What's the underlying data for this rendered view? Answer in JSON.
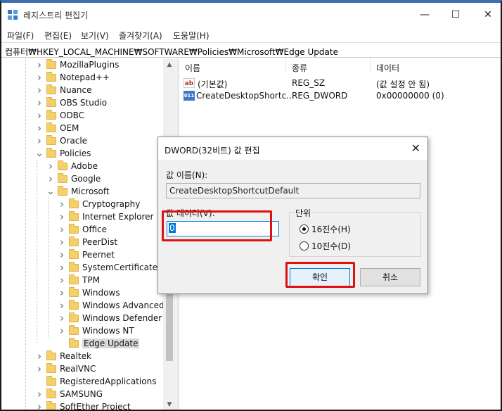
{
  "window": {
    "title": "레지스트리 편집기",
    "minimize": "—",
    "maximize": "☐",
    "close": "✕"
  },
  "menu": [
    "파일(F)",
    "편집(E)",
    "보기(V)",
    "즐겨찾기(A)",
    "도움말(H)"
  ],
  "address": "컴퓨터₩HKEY_LOCAL_MACHINE₩SOFTWARE₩Policies₩Microsoft₩Edge Update",
  "tree": [
    {
      "label": "MozillaPlugins",
      "level": 0,
      "expanded": false
    },
    {
      "label": "Notepad++",
      "level": 0,
      "expanded": false
    },
    {
      "label": "Nuance",
      "level": 0,
      "expanded": false
    },
    {
      "label": "OBS Studio",
      "level": 0,
      "expanded": false
    },
    {
      "label": "ODBC",
      "level": 0,
      "expanded": false
    },
    {
      "label": "OEM",
      "level": 0,
      "expanded": false
    },
    {
      "label": "Oracle",
      "level": 0,
      "expanded": false
    },
    {
      "label": "Policies",
      "level": 0,
      "expanded": true
    },
    {
      "label": "Adobe",
      "level": 1,
      "expanded": false
    },
    {
      "label": "Google",
      "level": 1,
      "expanded": false
    },
    {
      "label": "Microsoft",
      "level": 1,
      "expanded": true
    },
    {
      "label": "Cryptography",
      "level": 2,
      "expanded": false
    },
    {
      "label": "Internet Explorer",
      "level": 2,
      "expanded": false
    },
    {
      "label": "Office",
      "level": 2,
      "expanded": false
    },
    {
      "label": "PeerDist",
      "level": 2,
      "expanded": false
    },
    {
      "label": "Peernet",
      "level": 2,
      "expanded": false
    },
    {
      "label": "SystemCertificates",
      "level": 2,
      "expanded": false
    },
    {
      "label": "TPM",
      "level": 2,
      "expanded": false
    },
    {
      "label": "Windows",
      "level": 2,
      "expanded": false
    },
    {
      "label": "Windows Advanced",
      "level": 2,
      "expanded": false
    },
    {
      "label": "Windows Defender",
      "level": 2,
      "expanded": false
    },
    {
      "label": "Windows NT",
      "level": 2,
      "expanded": false
    },
    {
      "label": "Edge Update",
      "level": 2,
      "expanded": false,
      "selected": true,
      "leaf": true
    },
    {
      "label": "Realtek",
      "level": 0,
      "expanded": false
    },
    {
      "label": "RealVNC",
      "level": 0,
      "expanded": false
    },
    {
      "label": "RegisteredApplications",
      "level": 0,
      "expanded": false,
      "leaf": true
    },
    {
      "label": "SAMSUNG",
      "level": 0,
      "expanded": false
    },
    {
      "label": "SoftEther Project",
      "level": 0,
      "expanded": false
    }
  ],
  "list": {
    "headers": [
      "이름",
      "종류",
      "데이터"
    ],
    "rows": [
      {
        "icon": "ab",
        "name": "(기본값)",
        "type": "REG_SZ",
        "data": "(값 설정 안 됨)"
      },
      {
        "icon": "bin",
        "name": "CreateDesktopShortc...",
        "type": "REG_DWORD",
        "data": "0x00000000 (0)"
      }
    ]
  },
  "dialog": {
    "title": "DWORD(32비트) 값 편집",
    "close": "✕",
    "name_label": "값 이름(N):",
    "name_value": "CreateDesktopShortcutDefault",
    "data_label": "값 데이터(V):",
    "data_value": "0",
    "base_label": "단위",
    "hex_label": "16진수(H)",
    "dec_label": "10진수(D)",
    "ok": "확인",
    "cancel": "취소"
  },
  "colors": {
    "highlight": "#e01010",
    "accent": "#0078d7",
    "folder": "#f5cf69"
  }
}
